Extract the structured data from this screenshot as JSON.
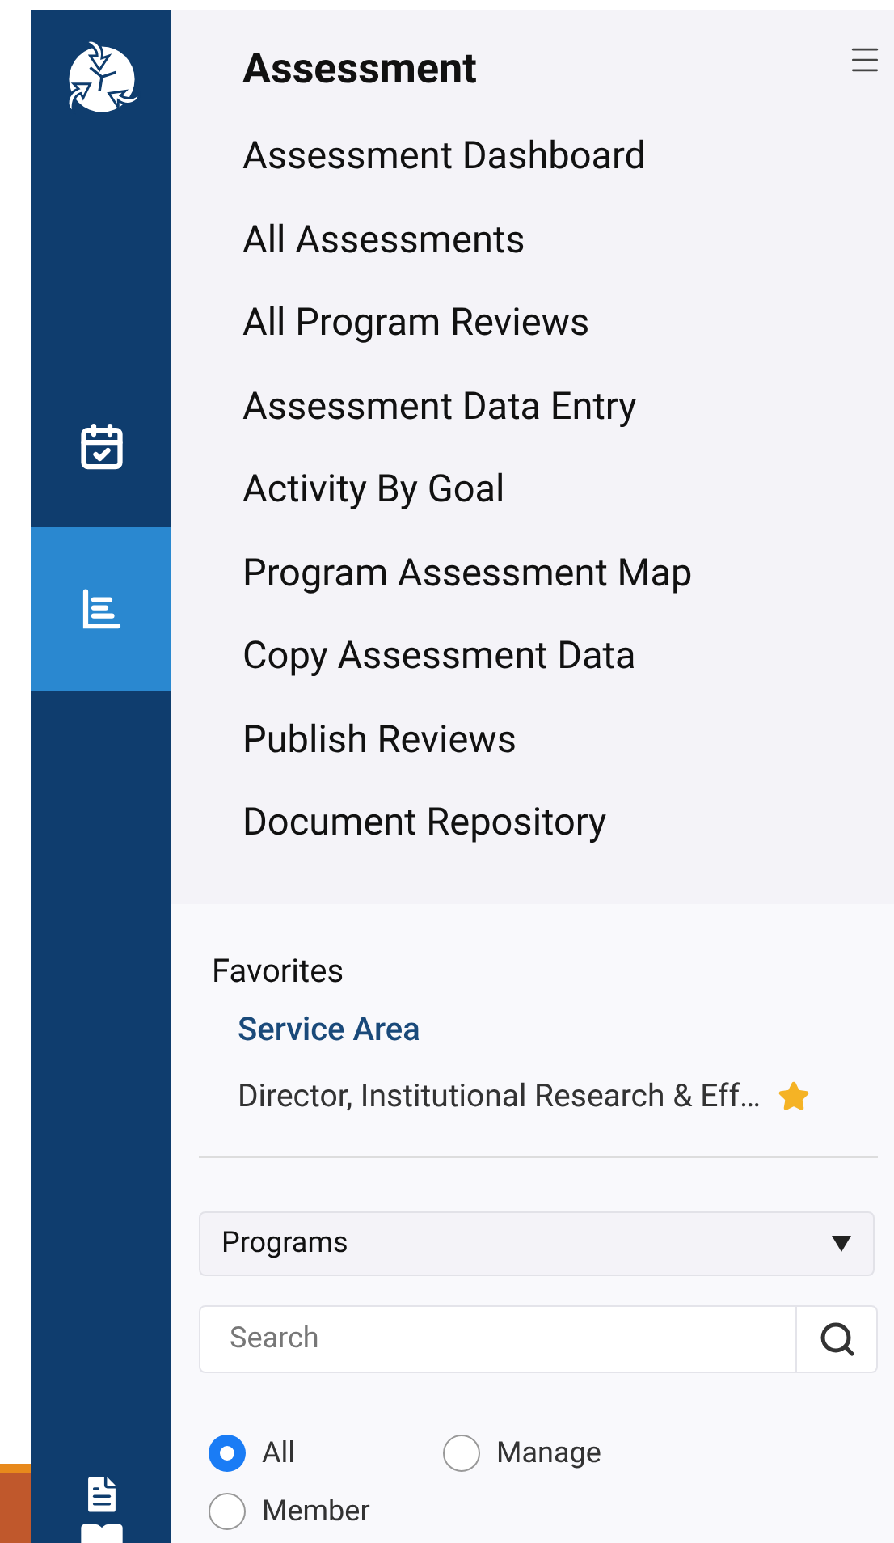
{
  "sidebar": {
    "items": [
      {
        "kind": "calendar",
        "selected": false
      },
      {
        "kind": "chart",
        "selected": true
      }
    ],
    "bottom_items": [
      {
        "kind": "document"
      },
      {
        "kind": "book"
      }
    ]
  },
  "menu": {
    "title": "Assessment",
    "items": [
      "Assessment Dashboard",
      "All Assessments",
      "All Program Reviews",
      "Assessment Data Entry",
      "Activity By Goal",
      "Program Assessment Map",
      "Copy Assessment Data",
      "Publish Reviews",
      "Document Repository"
    ]
  },
  "favorites": {
    "title": "Favorites",
    "group": "Service Area",
    "items": [
      {
        "label": "Director, Institutional Research & Eff…",
        "starred": true
      }
    ]
  },
  "filter": {
    "dropdown": "Programs",
    "search": {
      "placeholder": "Search"
    },
    "options": [
      {
        "label": "All",
        "selected": true
      },
      {
        "label": "Manage",
        "selected": false
      },
      {
        "label": "Member",
        "selected": false
      }
    ]
  }
}
